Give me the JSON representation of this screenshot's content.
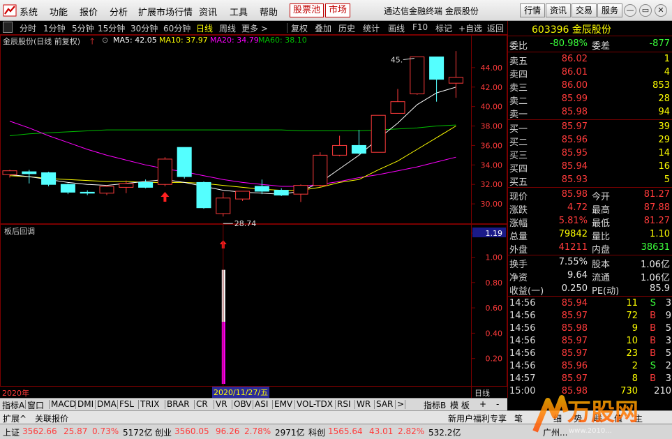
{
  "menu": {
    "items": [
      "系统",
      "功能",
      "报价",
      "分析",
      "扩展市场行情",
      "资讯",
      "工具",
      "帮助"
    ],
    "highlight": [
      "股票池",
      "市场"
    ],
    "app_title": "通达信金融终端  金辰股份",
    "right_buttons": [
      "行情",
      "资讯",
      "交易",
      "服务"
    ]
  },
  "period_bar": {
    "items": [
      "分时",
      "1分钟",
      "5分钟",
      "15分钟",
      "30分钟",
      "60分钟",
      "日线",
      "周线",
      "更多 >"
    ],
    "active": "日线",
    "tools": [
      "复权",
      "叠加",
      "历史",
      "统计",
      "画线",
      "F10",
      "标记",
      "+自选",
      "返回"
    ]
  },
  "chart_header": {
    "title": "金辰股份(日线 前复权)",
    "ma5": "MA5: 42.05",
    "ma10": "MA10: 37.97",
    "ma20": "MA20: 34.79",
    "ma60": "MA60: 38.10"
  },
  "chart_data": {
    "type": "candlestick",
    "y_ticks": [
      "44.00",
      "42.00",
      "40.00",
      "38.00",
      "36.00",
      "34.00",
      "32.00",
      "30.00"
    ],
    "ylim": [
      28.0,
      46.5
    ],
    "candles": [
      {
        "o": 33.0,
        "h": 33.5,
        "l": 32.7,
        "c": 33.4
      },
      {
        "o": 33.3,
        "h": 33.5,
        "l": 32.1,
        "c": 33.1
      },
      {
        "o": 33.2,
        "h": 33.3,
        "l": 31.8,
        "c": 32.0
      },
      {
        "o": 32.0,
        "h": 32.1,
        "l": 31.0,
        "c": 31.2
      },
      {
        "o": 31.2,
        "h": 31.4,
        "l": 30.9,
        "c": 31.1
      },
      {
        "o": 31.1,
        "h": 31.9,
        "l": 30.9,
        "c": 31.8
      },
      {
        "o": 31.7,
        "h": 32.4,
        "l": 31.1,
        "c": 32.1
      },
      {
        "o": 32.2,
        "h": 32.5,
        "l": 31.6,
        "c": 31.7
      },
      {
        "o": 32.0,
        "h": 34.8,
        "l": 31.8,
        "c": 34.6
      },
      {
        "o": 35.8,
        "h": 35.8,
        "l": 32.6,
        "c": 32.8
      },
      {
        "o": 32.2,
        "h": 32.3,
        "l": 29.5,
        "c": 29.6
      },
      {
        "o": 29.0,
        "h": 31.2,
        "l": 28.7,
        "c": 30.6
      },
      {
        "o": 30.5,
        "h": 31.3,
        "l": 30.3,
        "c": 31.3
      },
      {
        "o": 31.8,
        "h": 32.5,
        "l": 31.0,
        "c": 31.3
      },
      {
        "o": 31.4,
        "h": 31.6,
        "l": 30.8,
        "c": 30.9
      },
      {
        "o": 31.0,
        "h": 32.0,
        "l": 30.2,
        "c": 31.9
      },
      {
        "o": 31.9,
        "h": 35.3,
        "l": 31.7,
        "c": 35.0
      },
      {
        "o": 35.0,
        "h": 37.0,
        "l": 34.9,
        "c": 36.0
      },
      {
        "o": 36.0,
        "h": 37.6,
        "l": 35.1,
        "c": 35.2
      },
      {
        "o": 35.3,
        "h": 39.1,
        "l": 35.3,
        "c": 39.1
      },
      {
        "o": 39.3,
        "h": 41.8,
        "l": 39.3,
        "c": 40.5
      },
      {
        "o": 41.3,
        "h": 45.1,
        "l": 41.2,
        "c": 45.1
      },
      {
        "o": 45.1,
        "h": 45.1,
        "l": 40.5,
        "c": 42.8
      },
      {
        "o": 42.4,
        "h": 45.7,
        "l": 40.9,
        "c": 43.0
      }
    ],
    "ma5": [
      33.0,
      32.8,
      32.5,
      32.2,
      32.0,
      31.9,
      32.1,
      32.3,
      32.5,
      32.2,
      31.8,
      31.4,
      31.2,
      31.1,
      31.0,
      31.3,
      32.2,
      33.6,
      35.0,
      36.7,
      38.3,
      40.2,
      41.4,
      42.0
    ],
    "ma10": [
      32.9,
      32.8,
      32.6,
      32.5,
      32.4,
      32.3,
      32.3,
      32.2,
      32.2,
      32.2,
      32.1,
      31.9,
      31.7,
      31.5,
      31.4,
      31.4,
      31.7,
      32.2,
      32.5,
      33.5,
      34.4,
      35.6,
      36.8,
      38.0
    ],
    "ma20": [
      38.5,
      37.8,
      37.0,
      36.3,
      35.6,
      35.0,
      34.5,
      34.0,
      33.6,
      33.3,
      32.9,
      32.5,
      32.2,
      32.0,
      31.8,
      31.8,
      32.0,
      32.3,
      32.7,
      33.0,
      33.4,
      33.8,
      34.3,
      34.8
    ],
    "ma60": [
      37.0,
      37.2,
      37.3,
      37.4,
      37.5,
      37.6,
      37.6,
      37.6,
      37.6,
      37.6,
      37.6,
      37.6,
      37.6,
      37.6,
      37.6,
      37.5,
      37.5,
      37.5,
      37.5,
      37.6,
      37.7,
      37.8,
      38.0,
      38.1
    ],
    "annotations": [
      {
        "label": "45.",
        "candle": 21
      },
      {
        "label": "28.74",
        "candle": 11
      }
    ],
    "indicator": {
      "title": "板后回调",
      "y_ticks": [
        "1.19",
        "1.00",
        "0.80",
        "0.60",
        "0.40",
        "0.20"
      ],
      "ylim": [
        0.0,
        1.19
      ],
      "current": "1.19",
      "bar_candle": 11,
      "bar_top": 0.9,
      "bar_mid": 0.49
    },
    "x_labels": [
      "2020年",
      "2020/11/27/五"
    ],
    "cursor_candle": 11
  },
  "quote": {
    "code_name": "603396 金辰股份",
    "weibi": {
      "label": "委比",
      "value": "-80.98%",
      "label2": "委差",
      "value2": "-877"
    },
    "sell": [
      {
        "label": "卖五",
        "price": "86.02",
        "vol": "1"
      },
      {
        "label": "卖四",
        "price": "86.01",
        "vol": "4"
      },
      {
        "label": "卖三",
        "price": "86.00",
        "vol": "853"
      },
      {
        "label": "卖二",
        "price": "85.99",
        "vol": "28"
      },
      {
        "label": "卖一",
        "price": "85.98",
        "vol": "94"
      }
    ],
    "buy": [
      {
        "label": "买一",
        "price": "85.97",
        "vol": "39"
      },
      {
        "label": "买二",
        "price": "85.96",
        "vol": "29"
      },
      {
        "label": "买三",
        "price": "85.95",
        "vol": "14"
      },
      {
        "label": "买四",
        "price": "85.94",
        "vol": "16"
      },
      {
        "label": "买五",
        "price": "85.93",
        "vol": "5"
      }
    ],
    "stats": [
      {
        "l1": "现价",
        "v1": "85.98",
        "c1": "red",
        "l2": "今开",
        "v2": "81.27",
        "c2": "red"
      },
      {
        "l1": "涨跌",
        "v1": "4.72",
        "c1": "red",
        "l2": "最高",
        "v2": "87.88",
        "c2": "red"
      },
      {
        "l1": "涨幅",
        "v1": "5.81%",
        "c1": "red",
        "l2": "最低",
        "v2": "81.27",
        "c2": "red"
      },
      {
        "l1": "总量",
        "v1": "79842",
        "c1": "yellow",
        "l2": "量比",
        "v2": "1.10",
        "c2": "yellow"
      },
      {
        "l1": "外盘",
        "v1": "41211",
        "c1": "red",
        "l2": "内盘",
        "v2": "38631",
        "c2": "green"
      }
    ],
    "stats2": [
      {
        "l1": "换手",
        "v1": "7.55%",
        "l2": "股本",
        "v2": "1.06亿"
      },
      {
        "l1": "净资",
        "v1": "9.64",
        "l2": "流通",
        "v2": "1.06亿"
      },
      {
        "l1": "收益(一)",
        "v1": "0.250",
        "l2": "PE(动)",
        "v2": "85.9"
      }
    ],
    "ticks": [
      {
        "t": "14:56",
        "p": "85.94",
        "v": "11",
        "d": "S",
        "n": "3"
      },
      {
        "t": "14:56",
        "p": "85.97",
        "v": "72",
        "d": "B",
        "n": "9"
      },
      {
        "t": "14:56",
        "p": "85.98",
        "v": "9",
        "d": "B",
        "n": "5"
      },
      {
        "t": "14:56",
        "p": "85.97",
        "v": "10",
        "d": "B",
        "n": "3"
      },
      {
        "t": "14:56",
        "p": "85.97",
        "v": "23",
        "d": "B",
        "n": "5"
      },
      {
        "t": "14:56",
        "p": "85.96",
        "v": "2",
        "d": "S",
        "n": "2"
      },
      {
        "t": "14:57",
        "p": "85.97",
        "v": "8",
        "d": "B",
        "n": "3"
      },
      {
        "t": "15:00",
        "p": "85.98",
        "v": "730",
        "d": "",
        "n": "210"
      }
    ]
  },
  "indicator_tabs": [
    "指标A",
    "窗口",
    "MACD",
    "DMI",
    "DMA",
    "FSL",
    "TRIX",
    "BRAR",
    "CR",
    "VR",
    "OBV",
    "ASI",
    "EMV",
    "VOL-TDX",
    "RSI",
    "WR",
    "SAR",
    ">",
    "指标B",
    "模 板",
    "+",
    "-"
  ],
  "period_label": "日线",
  "subbar": {
    "left": [
      "扩展^",
      "关联报价"
    ],
    "right": [
      "新用户福利专享",
      "笔",
      "细",
      "势",
      "联",
      "值",
      "主"
    ]
  },
  "status": [
    {
      "l": "上证",
      "v1": "3562.66",
      "v2": "25.87",
      "v3": "0.73%",
      "v4": "5172亿"
    },
    {
      "l": "创业",
      "v1": "3560.05",
      "v2": "96.26",
      "v3": "2.78%",
      "v4": "2971亿"
    },
    {
      "l": "科创",
      "v1": "1565.64",
      "v2": "43.01",
      "v3": "2.82%",
      "v4": "532.2亿"
    }
  ],
  "status_right": "广州...",
  "watermark": {
    "brand": "万股网",
    "url": "www.2010..."
  },
  "colors": {
    "up": "#ff3b3b",
    "down": "#54ffff",
    "ma5": "#ffffff",
    "ma10": "#ffff00",
    "ma20": "#ff00ff",
    "ma60": "#00c000",
    "grid": "#7a0000"
  }
}
